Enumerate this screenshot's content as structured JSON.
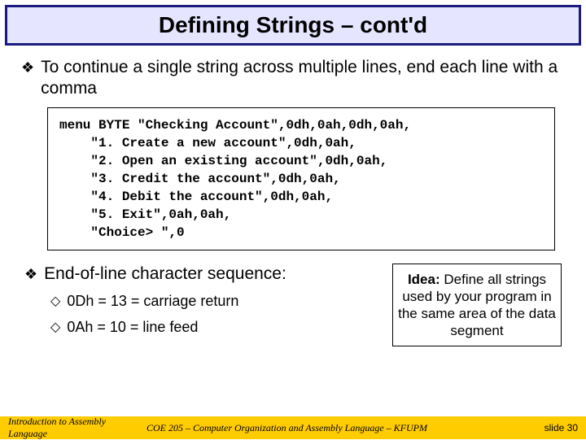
{
  "title": "Defining Strings – cont'd",
  "bullet1": "To continue a single string across multiple lines, end each line with a comma",
  "code": "menu BYTE \"Checking Account\",0dh,0ah,0dh,0ah,\n    \"1. Create a new account\",0dh,0ah,\n    \"2. Open an existing account\",0dh,0ah,\n    \"3. Credit the account\",0dh,0ah,\n    \"4. Debit the account\",0dh,0ah,\n    \"5. Exit\",0ah,0ah,\n    \"Choice> \",0",
  "bullet2": "End-of-line character sequence:",
  "sub1": "0Dh = 13 = carriage return",
  "sub2": "0Ah = 10 = line feed",
  "idea_label": "Idea:",
  "idea_text": " Define all strings used by your program in the same area of the data segment",
  "footer_left": "Introduction to Assembly Language",
  "footer_mid": "COE 205 – Computer Organization and Assembly Language – KFUPM",
  "footer_right": "slide 30"
}
